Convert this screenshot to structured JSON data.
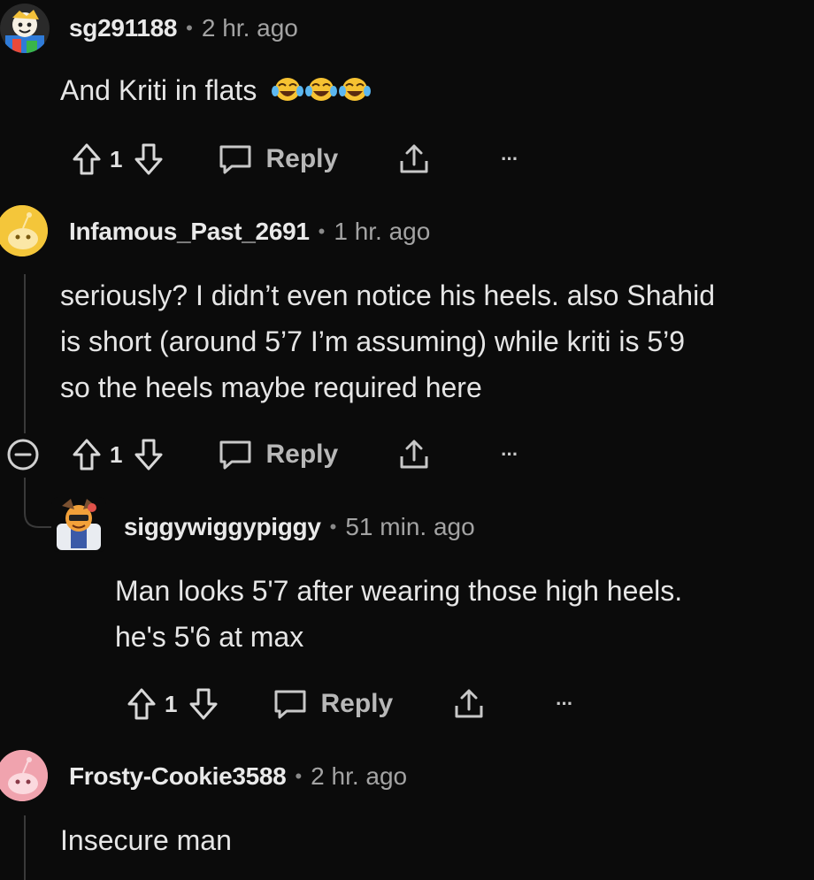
{
  "comments": [
    {
      "username": "sg291188",
      "time": "2 hr. ago",
      "text": "And Kriti in flats",
      "emoji": "😂😂😂",
      "votes": "1",
      "reply_label": "Reply",
      "more_label": "···"
    },
    {
      "username": "Infamous_Past_2691",
      "time": "1 hr. ago",
      "text_lines": [
        "seriously? I didn’t even notice his heels. also Shahid",
        "is short (around 5’7 I’m assuming) while kriti is 5’9",
        "so the heels maybe required here"
      ],
      "votes": "1",
      "reply_label": "Reply",
      "more_label": "···"
    },
    {
      "username": "siggywiggypiggy",
      "time": "51 min. ago",
      "text_lines": [
        "Man looks 5'7 after wearing those high heels.",
        "he's 5'6 at max"
      ],
      "votes": "1",
      "reply_label": "Reply",
      "more_label": "···"
    },
    {
      "username": "Frosty-Cookie3588",
      "time": "2 hr. ago",
      "text": "Insecure man"
    }
  ],
  "separator": "•",
  "colors": {
    "background": "#0b0b0b",
    "text": "#e6e6e6",
    "muted": "#a3a3a3",
    "avatar_yellow": "#f4c63a",
    "avatar_pink": "#f0a3ae"
  }
}
